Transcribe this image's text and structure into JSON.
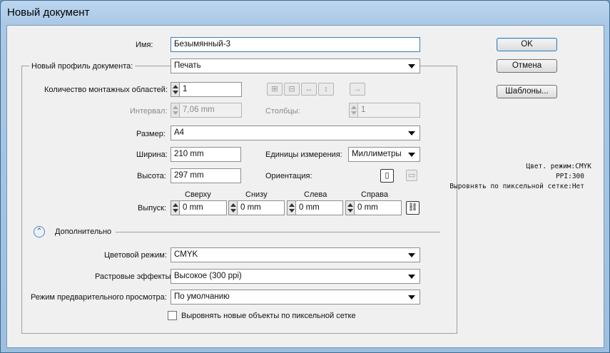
{
  "window": {
    "title": "Новый документ"
  },
  "name_field": {
    "label": "Имя:",
    "value": "Безымянный-3"
  },
  "profile": {
    "label": "Новый профиль документа:",
    "value": "Печать"
  },
  "artboards": {
    "count_label": "Количество монтажных областей:",
    "count_value": "1",
    "spacing_label": "Интервал:",
    "spacing_value": "7,06 mm",
    "columns_label": "Столбцы:",
    "columns_value": "1",
    "arrange_icons": [
      "grid-by-row-icon",
      "grid-by-column-icon",
      "arrange-by-row-icon",
      "arrange-by-column-icon",
      "right-to-left-icon"
    ]
  },
  "size": {
    "label": "Размер:",
    "value": "A4"
  },
  "width": {
    "label": "Ширина:",
    "value": "210 mm"
  },
  "height": {
    "label": "Высота:",
    "value": "297 mm"
  },
  "units": {
    "label": "Единицы измерения:",
    "value": "Миллиметры"
  },
  "orientation": {
    "label": "Ориентация:",
    "icons": [
      "portrait-icon",
      "landscape-icon"
    ],
    "selected": "portrait-icon"
  },
  "bleed": {
    "label": "Выпуск:",
    "top_label": "Сверху",
    "top_value": "0 mm",
    "bottom_label": "Снизу",
    "bottom_value": "0 mm",
    "left_label": "Слева",
    "left_value": "0 mm",
    "right_label": "Справа",
    "right_value": "0 mm",
    "link_icon": "link-icon"
  },
  "advanced": {
    "label": "Дополнительно",
    "color_mode_label": "Цветовой режим:",
    "color_mode_value": "CMYK",
    "raster_label": "Растровые эффекты:",
    "raster_value": "Высокое (300 ppi)",
    "preview_label": "Режим предварительного просмотра:",
    "preview_value": "По умолчанию",
    "align_label": "Выровнять новые объекты по пиксельной сетке",
    "align_checked": false
  },
  "buttons": {
    "ok": "OK",
    "cancel": "Отмена",
    "templates": "Шаблоны..."
  },
  "summary": {
    "color_mode": "Цвет. режим:CMYK",
    "ppi": "PPI:300",
    "pixel_align": "Выровнять по пиксельной сетке:Нет"
  },
  "colors": {
    "accent_border": "#3c7fb1",
    "title_bg": "#a9c8e6",
    "client_bg": "#f0f0f0"
  }
}
